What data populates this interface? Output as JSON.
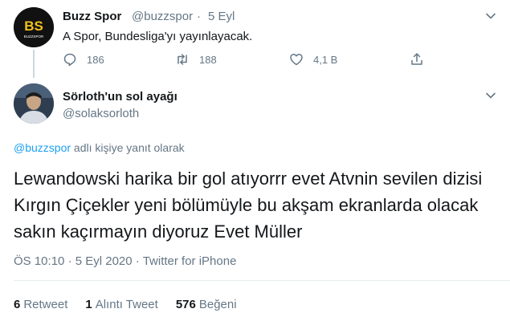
{
  "parent_tweet": {
    "display_name": "Buzz Spor",
    "handle": "@buzzspor",
    "separator": "·",
    "date": "5 Eyl",
    "text": "A Spor, Bundesliga'yı yayınlayacak.",
    "logo_text": "BS",
    "logo_subtext": "BUZZSPOR",
    "actions": {
      "reply_count": "186",
      "retweet_count": "188",
      "like_count": "4,1 B"
    }
  },
  "main_tweet": {
    "display_name": "Sörloth'un sol ayağı",
    "handle": "@solaksorloth",
    "reply_to": {
      "handle": "@buzzspor",
      "suffix": " adlı kişiye yanıt olarak"
    },
    "text": "Lewandowski harika bir gol atıyorrr evet Atvnin sevilen dizisi Kırgın Çiçekler yeni bölümüyle bu akşam ekranlarda olacak sakın kaçırmayın diyoruz Evet Müller",
    "meta": {
      "time": "ÖS 10:10",
      "date": "5 Eyl 2020",
      "source": "Twitter for iPhone",
      "separator": "·"
    },
    "stats": {
      "retweets_count": "6",
      "retweets_label": "Retweet",
      "quotes_count": "1",
      "quotes_label": "Alıntı Tweet",
      "likes_count": "576",
      "likes_label": "Beğeni"
    }
  },
  "colors": {
    "accent": "#1da1f2",
    "secondary_text": "#657786",
    "primary_text": "#14171a",
    "divider": "#e6ecf0"
  },
  "icons": [
    "chevron-down-icon",
    "reply-icon",
    "retweet-icon",
    "like-icon",
    "share-icon"
  ]
}
